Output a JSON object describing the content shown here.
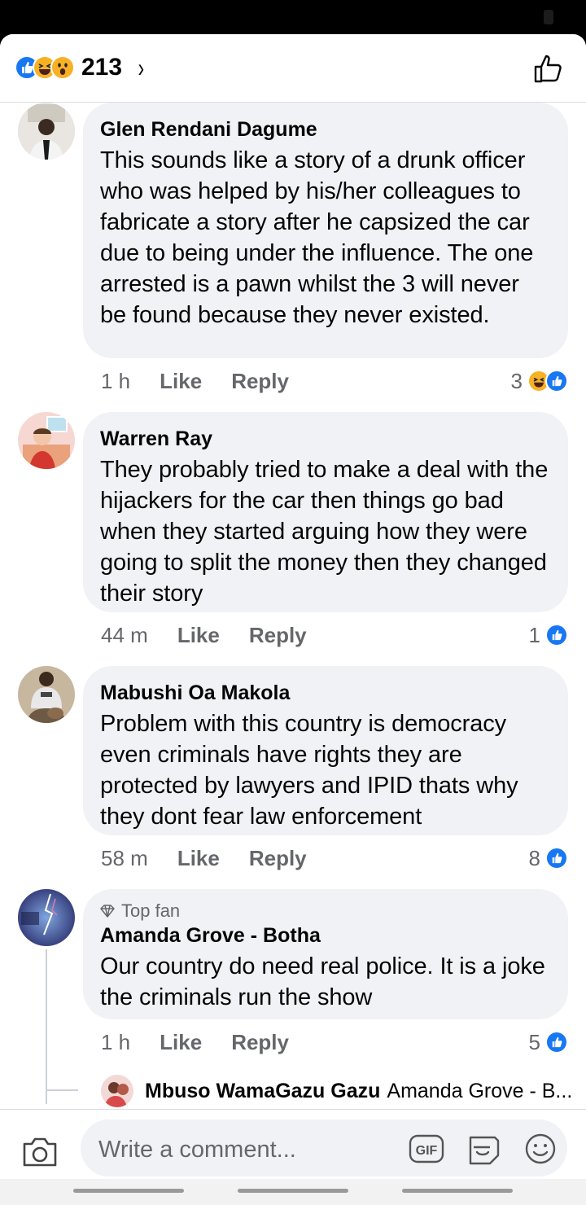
{
  "header": {
    "reaction_count": "213",
    "reaction_icons": [
      "like-icon",
      "haha-icon",
      "wow-icon"
    ],
    "chevron": "›"
  },
  "comments": [
    {
      "name": "Glen Rendani Dagume",
      "text": "This sounds like a story of a drunk officer who was helped by his/her colleagues to fabricate a story after he capsized the car due to being under the influence. The one arrested is a pawn whilst the 3 will never be found because they never existed.",
      "time": "1 h",
      "like": "Like",
      "reply": "Reply",
      "reactions": "3"
    },
    {
      "name": "Warren Ray",
      "text": "They probably tried to make a deal with the hijackers for the car then things go bad when they started arguing how they were going to split the money then they changed their story",
      "time": "44 m",
      "like": "Like",
      "reply": "Reply",
      "reactions": "1"
    },
    {
      "name": "Mabushi Oa Makola",
      "text": "Problem with this country is democracy even criminals have rights they are protected by lawyers and  IPID thats why they dont fear law enforcement",
      "time": "58 m",
      "like": "Like",
      "reply": "Reply",
      "reactions": "8"
    },
    {
      "badge": "Top fan",
      "name": "Amanda Grove - Botha",
      "text": "Our country do need real police. It is a joke the criminals run the show",
      "time": "1 h",
      "like": "Like",
      "reply": "Reply",
      "reactions": "5"
    }
  ],
  "reply_preview": {
    "name": "Mbuso WamaGazu Gazu",
    "snippet": "Amanda Grove - B..."
  },
  "composer": {
    "placeholder": "Write a comment...",
    "gif_label": "GIF"
  },
  "colors": {
    "accent": "#1877f2",
    "bubble": "#f0f2f5",
    "meta": "#65676b"
  }
}
